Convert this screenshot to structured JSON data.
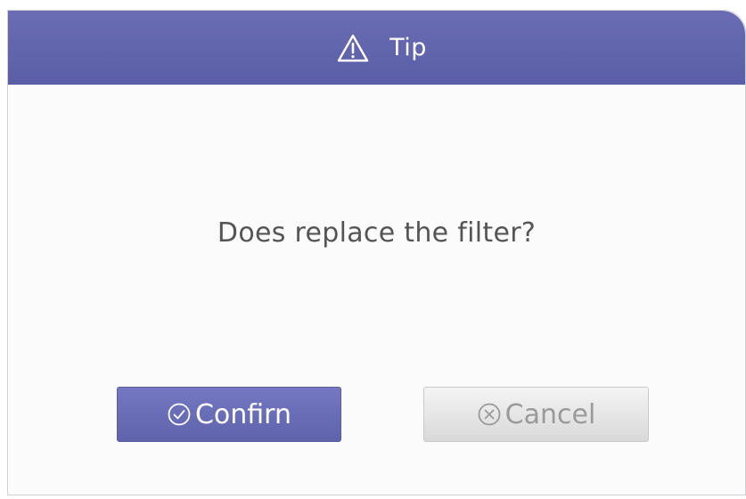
{
  "dialog": {
    "title": "Tip",
    "title_icon": "warning-triangle-icon",
    "message": "Does replace the filter?",
    "confirm_label": "Confirn",
    "confirm_icon": "check-circle-icon",
    "cancel_label": "Cancel",
    "cancel_icon": "x-circle-icon"
  },
  "colors": {
    "titlebar": "#5f63ab",
    "confirm_button": "#6a6eb8",
    "cancel_button": "#e3e3e3",
    "message_text": "#555555"
  }
}
